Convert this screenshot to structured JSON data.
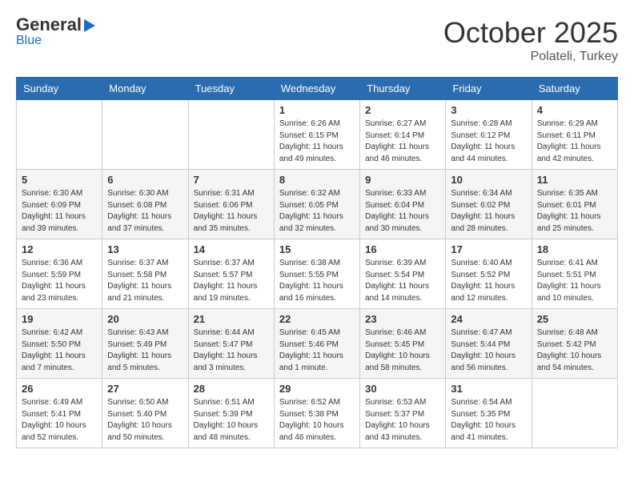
{
  "header": {
    "logo_general": "General",
    "logo_blue": "Blue",
    "month": "October 2025",
    "location": "Polateli, Turkey"
  },
  "days_of_week": [
    "Sunday",
    "Monday",
    "Tuesday",
    "Wednesday",
    "Thursday",
    "Friday",
    "Saturday"
  ],
  "weeks": [
    [
      {
        "day": "",
        "info": ""
      },
      {
        "day": "",
        "info": ""
      },
      {
        "day": "",
        "info": ""
      },
      {
        "day": "1",
        "info": "Sunrise: 6:26 AM\nSunset: 6:15 PM\nDaylight: 11 hours and 49 minutes."
      },
      {
        "day": "2",
        "info": "Sunrise: 6:27 AM\nSunset: 6:14 PM\nDaylight: 11 hours and 46 minutes."
      },
      {
        "day": "3",
        "info": "Sunrise: 6:28 AM\nSunset: 6:12 PM\nDaylight: 11 hours and 44 minutes."
      },
      {
        "day": "4",
        "info": "Sunrise: 6:29 AM\nSunset: 6:11 PM\nDaylight: 11 hours and 42 minutes."
      }
    ],
    [
      {
        "day": "5",
        "info": "Sunrise: 6:30 AM\nSunset: 6:09 PM\nDaylight: 11 hours and 39 minutes."
      },
      {
        "day": "6",
        "info": "Sunrise: 6:30 AM\nSunset: 6:08 PM\nDaylight: 11 hours and 37 minutes."
      },
      {
        "day": "7",
        "info": "Sunrise: 6:31 AM\nSunset: 6:06 PM\nDaylight: 11 hours and 35 minutes."
      },
      {
        "day": "8",
        "info": "Sunrise: 6:32 AM\nSunset: 6:05 PM\nDaylight: 11 hours and 32 minutes."
      },
      {
        "day": "9",
        "info": "Sunrise: 6:33 AM\nSunset: 6:04 PM\nDaylight: 11 hours and 30 minutes."
      },
      {
        "day": "10",
        "info": "Sunrise: 6:34 AM\nSunset: 6:02 PM\nDaylight: 11 hours and 28 minutes."
      },
      {
        "day": "11",
        "info": "Sunrise: 6:35 AM\nSunset: 6:01 PM\nDaylight: 11 hours and 25 minutes."
      }
    ],
    [
      {
        "day": "12",
        "info": "Sunrise: 6:36 AM\nSunset: 5:59 PM\nDaylight: 11 hours and 23 minutes."
      },
      {
        "day": "13",
        "info": "Sunrise: 6:37 AM\nSunset: 5:58 PM\nDaylight: 11 hours and 21 minutes."
      },
      {
        "day": "14",
        "info": "Sunrise: 6:37 AM\nSunset: 5:57 PM\nDaylight: 11 hours and 19 minutes."
      },
      {
        "day": "15",
        "info": "Sunrise: 6:38 AM\nSunset: 5:55 PM\nDaylight: 11 hours and 16 minutes."
      },
      {
        "day": "16",
        "info": "Sunrise: 6:39 AM\nSunset: 5:54 PM\nDaylight: 11 hours and 14 minutes."
      },
      {
        "day": "17",
        "info": "Sunrise: 6:40 AM\nSunset: 5:52 PM\nDaylight: 11 hours and 12 minutes."
      },
      {
        "day": "18",
        "info": "Sunrise: 6:41 AM\nSunset: 5:51 PM\nDaylight: 11 hours and 10 minutes."
      }
    ],
    [
      {
        "day": "19",
        "info": "Sunrise: 6:42 AM\nSunset: 5:50 PM\nDaylight: 11 hours and 7 minutes."
      },
      {
        "day": "20",
        "info": "Sunrise: 6:43 AM\nSunset: 5:49 PM\nDaylight: 11 hours and 5 minutes."
      },
      {
        "day": "21",
        "info": "Sunrise: 6:44 AM\nSunset: 5:47 PM\nDaylight: 11 hours and 3 minutes."
      },
      {
        "day": "22",
        "info": "Sunrise: 6:45 AM\nSunset: 5:46 PM\nDaylight: 11 hours and 1 minute."
      },
      {
        "day": "23",
        "info": "Sunrise: 6:46 AM\nSunset: 5:45 PM\nDaylight: 10 hours and 58 minutes."
      },
      {
        "day": "24",
        "info": "Sunrise: 6:47 AM\nSunset: 5:44 PM\nDaylight: 10 hours and 56 minutes."
      },
      {
        "day": "25",
        "info": "Sunrise: 6:48 AM\nSunset: 5:42 PM\nDaylight: 10 hours and 54 minutes."
      }
    ],
    [
      {
        "day": "26",
        "info": "Sunrise: 6:49 AM\nSunset: 5:41 PM\nDaylight: 10 hours and 52 minutes."
      },
      {
        "day": "27",
        "info": "Sunrise: 6:50 AM\nSunset: 5:40 PM\nDaylight: 10 hours and 50 minutes."
      },
      {
        "day": "28",
        "info": "Sunrise: 6:51 AM\nSunset: 5:39 PM\nDaylight: 10 hours and 48 minutes."
      },
      {
        "day": "29",
        "info": "Sunrise: 6:52 AM\nSunset: 5:38 PM\nDaylight: 10 hours and 46 minutes."
      },
      {
        "day": "30",
        "info": "Sunrise: 6:53 AM\nSunset: 5:37 PM\nDaylight: 10 hours and 43 minutes."
      },
      {
        "day": "31",
        "info": "Sunrise: 6:54 AM\nSunset: 5:35 PM\nDaylight: 10 hours and 41 minutes."
      },
      {
        "day": "",
        "info": ""
      }
    ]
  ]
}
